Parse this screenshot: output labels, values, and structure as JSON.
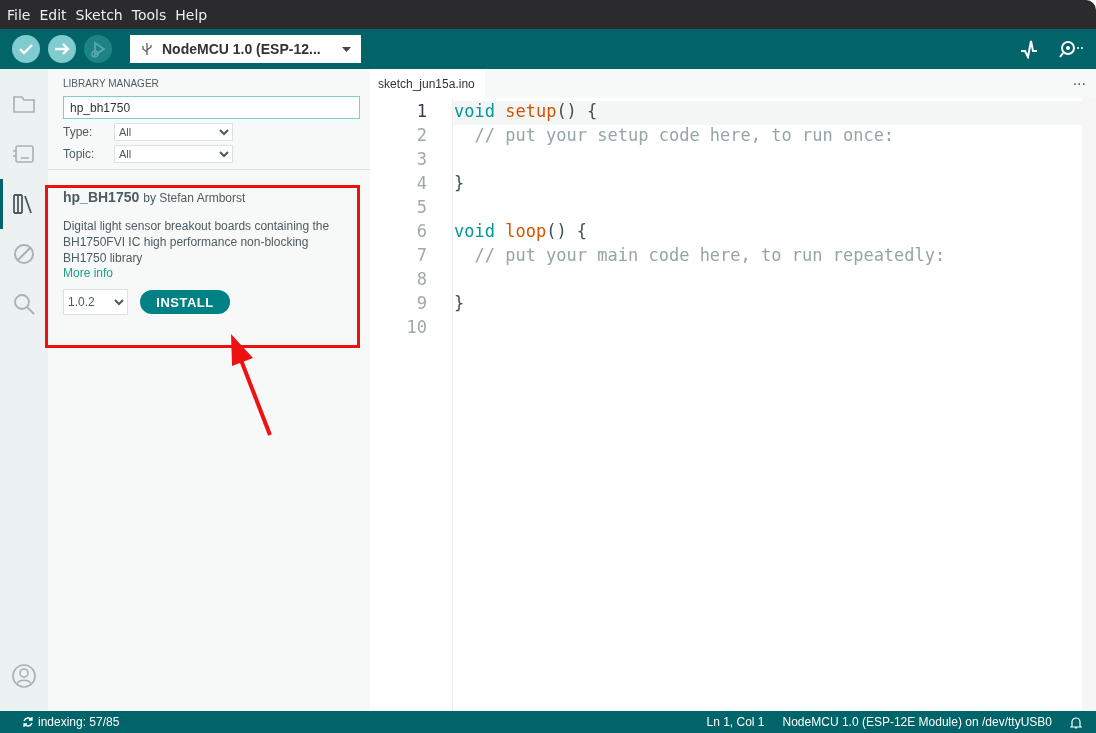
{
  "menu": [
    "File",
    "Edit",
    "Sketch",
    "Tools",
    "Help"
  ],
  "toolbar": {
    "buttons": [
      {
        "kind": "verify",
        "disabled": false
      },
      {
        "kind": "upload",
        "disabled": false
      },
      {
        "kind": "debug",
        "disabled": true
      }
    ],
    "board": "NodeMCU 1.0 (ESP-12..."
  },
  "rail": [
    {
      "kind": "folder",
      "selected": false
    },
    {
      "kind": "board",
      "selected": false
    },
    {
      "kind": "library",
      "selected": true
    },
    {
      "kind": "debug",
      "selected": false
    },
    {
      "kind": "search",
      "selected": false
    }
  ],
  "library_manager": {
    "title": "LIBRARY MANAGER",
    "search": "hp_bh1750",
    "filters": [
      {
        "label": "Type:",
        "value": "All"
      },
      {
        "label": "Topic:",
        "value": "All"
      }
    ],
    "results": [
      {
        "name": "hp_BH1750",
        "author": "by Stefan Armborst",
        "description": "Digital light sensor breakout boards containing the BH1750FVI IC high performance non-blocking BH1750 library",
        "link": "More info",
        "version": "1.0.2",
        "action": "INSTALL"
      }
    ]
  },
  "editor": {
    "tab": "sketch_jun15a.ino",
    "more": "···",
    "lines": [
      {
        "number": "1",
        "selected": true,
        "tokens": [
          {
            "kind": "keyword",
            "text": "void "
          },
          {
            "kind": "function",
            "text": "setup"
          },
          {
            "kind": "plain",
            "text": "() {"
          }
        ]
      },
      {
        "number": "2",
        "selected": false,
        "tokens": [
          {
            "kind": "comment",
            "text": "  // put your setup code here, to run once:"
          }
        ]
      },
      {
        "number": "3",
        "selected": false
      },
      {
        "number": "4",
        "selected": false,
        "tokens": [
          {
            "kind": "plain",
            "text": "}"
          }
        ]
      },
      {
        "number": "5",
        "selected": false
      },
      {
        "number": "6",
        "selected": false,
        "tokens": [
          {
            "kind": "keyword",
            "text": "void "
          },
          {
            "kind": "function",
            "text": "loop"
          },
          {
            "kind": "plain",
            "text": "() {"
          }
        ]
      },
      {
        "number": "7",
        "selected": false,
        "tokens": [
          {
            "kind": "comment",
            "text": "  // put your main code here, to run repeatedly:"
          }
        ]
      },
      {
        "number": "8",
        "selected": false
      },
      {
        "number": "9",
        "selected": false,
        "tokens": [
          {
            "kind": "plain",
            "text": "}"
          }
        ]
      },
      {
        "number": "10",
        "selected": false
      }
    ]
  },
  "status_bar": {
    "indexing": "indexing: 57/85",
    "position": "Ln 1, Col 1",
    "board": "NodeMCU 1.0 (ESP-12E Module) on /dev/ttyUSB0"
  },
  "annotation": {
    "highlight_box": true,
    "arrow": true
  }
}
